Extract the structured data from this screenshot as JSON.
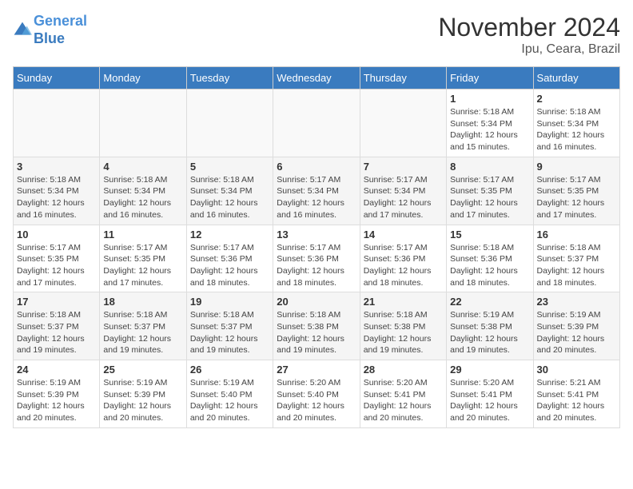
{
  "header": {
    "logo_line1": "General",
    "logo_line2": "Blue",
    "month": "November 2024",
    "location": "Ipu, Ceara, Brazil"
  },
  "weekdays": [
    "Sunday",
    "Monday",
    "Tuesday",
    "Wednesday",
    "Thursday",
    "Friday",
    "Saturday"
  ],
  "weeks": [
    [
      {
        "day": "",
        "info": ""
      },
      {
        "day": "",
        "info": ""
      },
      {
        "day": "",
        "info": ""
      },
      {
        "day": "",
        "info": ""
      },
      {
        "day": "",
        "info": ""
      },
      {
        "day": "1",
        "info": "Sunrise: 5:18 AM\nSunset: 5:34 PM\nDaylight: 12 hours\nand 15 minutes."
      },
      {
        "day": "2",
        "info": "Sunrise: 5:18 AM\nSunset: 5:34 PM\nDaylight: 12 hours\nand 16 minutes."
      }
    ],
    [
      {
        "day": "3",
        "info": "Sunrise: 5:18 AM\nSunset: 5:34 PM\nDaylight: 12 hours\nand 16 minutes."
      },
      {
        "day": "4",
        "info": "Sunrise: 5:18 AM\nSunset: 5:34 PM\nDaylight: 12 hours\nand 16 minutes."
      },
      {
        "day": "5",
        "info": "Sunrise: 5:18 AM\nSunset: 5:34 PM\nDaylight: 12 hours\nand 16 minutes."
      },
      {
        "day": "6",
        "info": "Sunrise: 5:17 AM\nSunset: 5:34 PM\nDaylight: 12 hours\nand 16 minutes."
      },
      {
        "day": "7",
        "info": "Sunrise: 5:17 AM\nSunset: 5:34 PM\nDaylight: 12 hours\nand 17 minutes."
      },
      {
        "day": "8",
        "info": "Sunrise: 5:17 AM\nSunset: 5:35 PM\nDaylight: 12 hours\nand 17 minutes."
      },
      {
        "day": "9",
        "info": "Sunrise: 5:17 AM\nSunset: 5:35 PM\nDaylight: 12 hours\nand 17 minutes."
      }
    ],
    [
      {
        "day": "10",
        "info": "Sunrise: 5:17 AM\nSunset: 5:35 PM\nDaylight: 12 hours\nand 17 minutes."
      },
      {
        "day": "11",
        "info": "Sunrise: 5:17 AM\nSunset: 5:35 PM\nDaylight: 12 hours\nand 17 minutes."
      },
      {
        "day": "12",
        "info": "Sunrise: 5:17 AM\nSunset: 5:36 PM\nDaylight: 12 hours\nand 18 minutes."
      },
      {
        "day": "13",
        "info": "Sunrise: 5:17 AM\nSunset: 5:36 PM\nDaylight: 12 hours\nand 18 minutes."
      },
      {
        "day": "14",
        "info": "Sunrise: 5:17 AM\nSunset: 5:36 PM\nDaylight: 12 hours\nand 18 minutes."
      },
      {
        "day": "15",
        "info": "Sunrise: 5:18 AM\nSunset: 5:36 PM\nDaylight: 12 hours\nand 18 minutes."
      },
      {
        "day": "16",
        "info": "Sunrise: 5:18 AM\nSunset: 5:37 PM\nDaylight: 12 hours\nand 18 minutes."
      }
    ],
    [
      {
        "day": "17",
        "info": "Sunrise: 5:18 AM\nSunset: 5:37 PM\nDaylight: 12 hours\nand 19 minutes."
      },
      {
        "day": "18",
        "info": "Sunrise: 5:18 AM\nSunset: 5:37 PM\nDaylight: 12 hours\nand 19 minutes."
      },
      {
        "day": "19",
        "info": "Sunrise: 5:18 AM\nSunset: 5:37 PM\nDaylight: 12 hours\nand 19 minutes."
      },
      {
        "day": "20",
        "info": "Sunrise: 5:18 AM\nSunset: 5:38 PM\nDaylight: 12 hours\nand 19 minutes."
      },
      {
        "day": "21",
        "info": "Sunrise: 5:18 AM\nSunset: 5:38 PM\nDaylight: 12 hours\nand 19 minutes."
      },
      {
        "day": "22",
        "info": "Sunrise: 5:19 AM\nSunset: 5:38 PM\nDaylight: 12 hours\nand 19 minutes."
      },
      {
        "day": "23",
        "info": "Sunrise: 5:19 AM\nSunset: 5:39 PM\nDaylight: 12 hours\nand 20 minutes."
      }
    ],
    [
      {
        "day": "24",
        "info": "Sunrise: 5:19 AM\nSunset: 5:39 PM\nDaylight: 12 hours\nand 20 minutes."
      },
      {
        "day": "25",
        "info": "Sunrise: 5:19 AM\nSunset: 5:39 PM\nDaylight: 12 hours\nand 20 minutes."
      },
      {
        "day": "26",
        "info": "Sunrise: 5:19 AM\nSunset: 5:40 PM\nDaylight: 12 hours\nand 20 minutes."
      },
      {
        "day": "27",
        "info": "Sunrise: 5:20 AM\nSunset: 5:40 PM\nDaylight: 12 hours\nand 20 minutes."
      },
      {
        "day": "28",
        "info": "Sunrise: 5:20 AM\nSunset: 5:41 PM\nDaylight: 12 hours\nand 20 minutes."
      },
      {
        "day": "29",
        "info": "Sunrise: 5:20 AM\nSunset: 5:41 PM\nDaylight: 12 hours\nand 20 minutes."
      },
      {
        "day": "30",
        "info": "Sunrise: 5:21 AM\nSunset: 5:41 PM\nDaylight: 12 hours\nand 20 minutes."
      }
    ]
  ]
}
